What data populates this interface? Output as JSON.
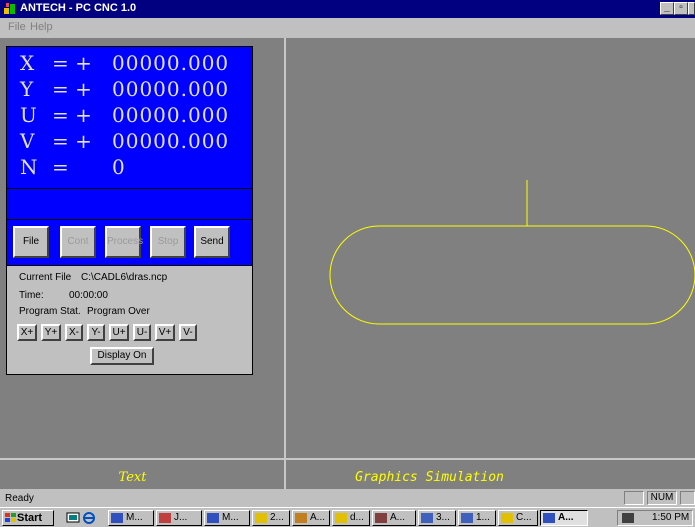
{
  "window": {
    "title": "ANTECH - PC CNC 1.0",
    "buttons": {
      "minimize": "_",
      "maximize": "▫",
      "close": "×"
    }
  },
  "menu": [
    "File",
    "Help"
  ],
  "dro": {
    "rows": [
      {
        "axis": "X",
        "sign": "= +",
        "value": "00000.000"
      },
      {
        "axis": "Y",
        "sign": "= +",
        "value": "00000.000"
      },
      {
        "axis": "U",
        "sign": "= +",
        "value": "00000.000"
      },
      {
        "axis": "V",
        "sign": "= +",
        "value": "00000.000"
      },
      {
        "axis": "N",
        "sign": "=",
        "value": "0"
      }
    ]
  },
  "toolbar": {
    "file": "File",
    "cont": "Cont",
    "process": "Process",
    "stop": "Stop",
    "send": "Send"
  },
  "info": {
    "current_file_label": "Current File",
    "current_file_value": "C:\\CADL6\\dras.ncp",
    "time_label": "Time:",
    "time_value": "00:00:00",
    "program_stat_label": "Program Stat.",
    "program_stat_value": "Program Over",
    "jog": [
      "X+",
      "Y+",
      "X-",
      "Y-",
      "U+",
      "U-",
      "V+",
      "V-"
    ],
    "display_button": "Display On"
  },
  "tabs": {
    "text": "Text",
    "graphics": "Graphics Simulation"
  },
  "colors": {
    "dro_bg": "#0000ff",
    "sim_path": "#ffff00",
    "sim_bg": "#808080"
  },
  "status": {
    "ready": "Ready",
    "num": "NUM"
  },
  "taskbar": {
    "start": "Start",
    "tasks": [
      "M...",
      "J...",
      "M...",
      "2...",
      "A...",
      "d...",
      "A...",
      "3...",
      "1...",
      "C...",
      "A..."
    ],
    "clock": "1:50 PM"
  }
}
